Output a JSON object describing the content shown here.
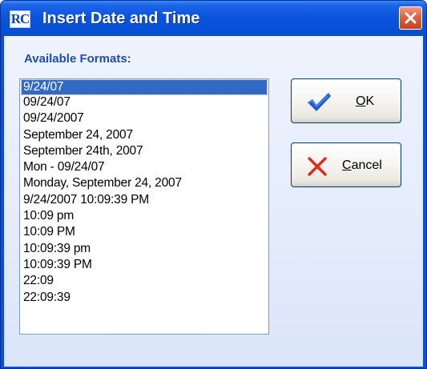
{
  "window": {
    "title": "Insert Date and Time",
    "app_icon_text": "RC"
  },
  "formats": {
    "label": "Available Formats:",
    "selected_index": 0,
    "items": [
      "9/24/07",
      "09/24/07",
      "09/24/2007",
      "September 24, 2007",
      "September 24th, 2007",
      "Mon - 09/24/07",
      "Monday, September 24, 2007",
      "9/24/2007 10:09:39 PM",
      "10:09 pm",
      "10:09 PM",
      "10:09:39 pm",
      "10:09:39 PM",
      "22:09",
      "22:09:39"
    ]
  },
  "buttons": {
    "ok": {
      "label_first": "O",
      "label_rest": "K",
      "icon": "checkmark-icon"
    },
    "cancel": {
      "label_first": "C",
      "label_rest": "ancel",
      "icon": "x-icon"
    },
    "close_icon": "close-icon"
  },
  "colors": {
    "titlebar": "#0a55dd",
    "selection": "#316ac5",
    "label": "#1f4cae",
    "check": "#1e5cd0",
    "cancel_x": "#e8261a",
    "close_button": "#e1603f"
  }
}
